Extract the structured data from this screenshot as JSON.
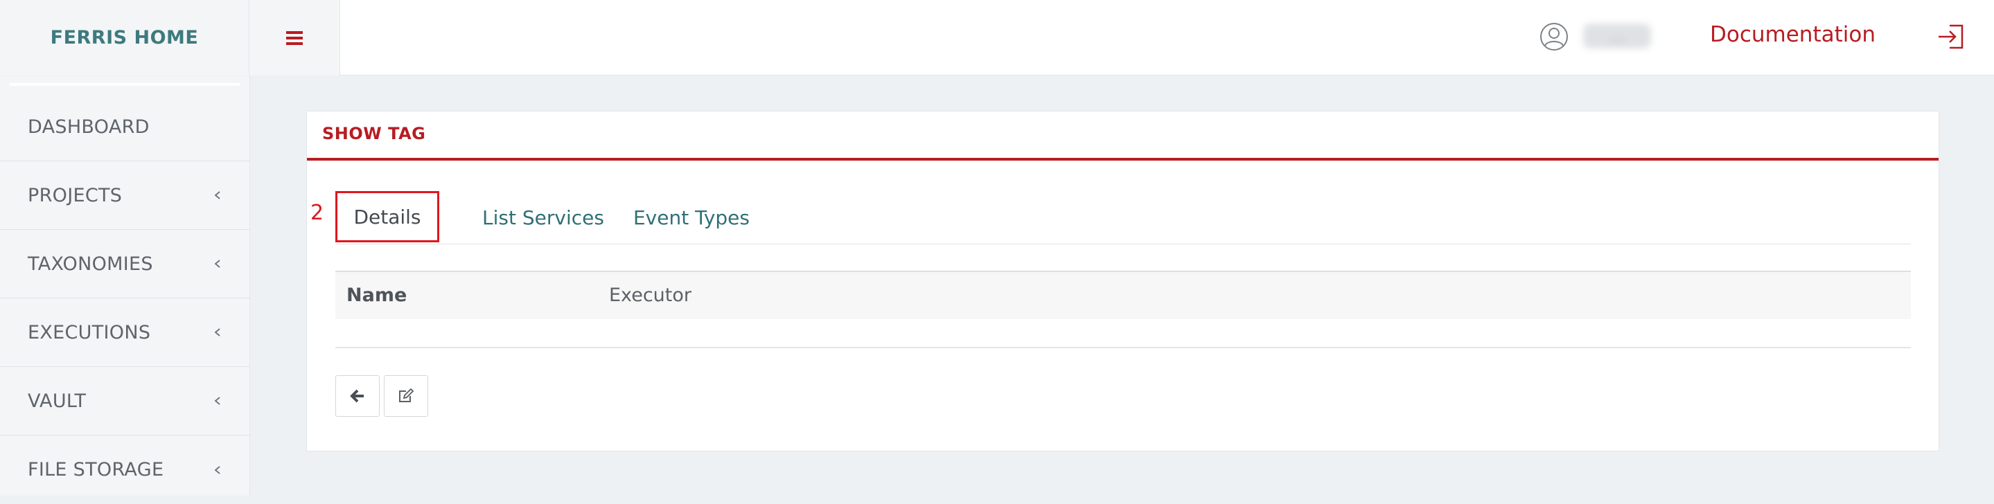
{
  "header": {
    "brand": "FERRIS HOME",
    "menu_icon": "hamburger-icon",
    "user_icon": "user-circle-icon",
    "username": "...",
    "documentation_label": "Documentation",
    "logout_icon": "sign-out-icon"
  },
  "sidebar": {
    "items": [
      {
        "label": "DASHBOARD",
        "has_submenu": false
      },
      {
        "label": "PROJECTS",
        "has_submenu": true
      },
      {
        "label": "TAXONOMIES",
        "has_submenu": true
      },
      {
        "label": "EXECUTIONS",
        "has_submenu": true
      },
      {
        "label": "VAULT",
        "has_submenu": true
      },
      {
        "label": "FILE STORAGE",
        "has_submenu": true
      }
    ]
  },
  "panel": {
    "title": "SHOW TAG",
    "annotation": "2",
    "tabs": [
      {
        "label": "Details",
        "active": true
      },
      {
        "label": "List Services",
        "active": false
      },
      {
        "label": "Event Types",
        "active": false
      }
    ],
    "details": [
      {
        "key": "Name",
        "value": "Executor"
      }
    ],
    "actions": {
      "back_icon": "arrow-left-icon",
      "edit_icon": "edit-icon"
    }
  },
  "colors": {
    "accent": "#b81c22",
    "brand_teal": "#3d7a7f",
    "tab_link": "#2f7076",
    "annotation_red": "#e0161c",
    "background": "#eef1f4"
  }
}
